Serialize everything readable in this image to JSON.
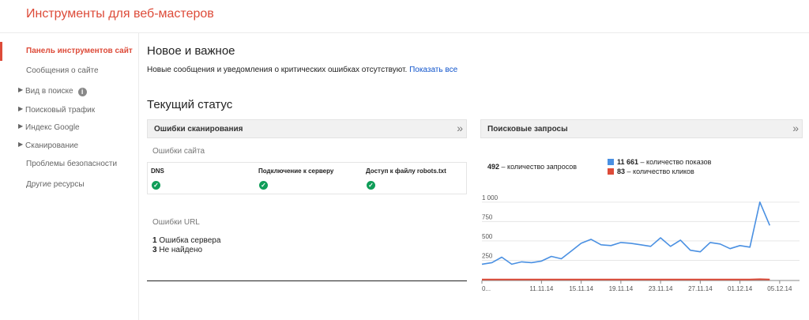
{
  "app": {
    "title": "Инструменты для веб-мастеров"
  },
  "sidebar": {
    "items": [
      {
        "label": "Панель инструментов сайт",
        "active": true,
        "expandable": false
      },
      {
        "label": "Сообщения о сайте",
        "active": false,
        "expandable": false
      },
      {
        "label": "Вид в поиске",
        "active": false,
        "expandable": true,
        "icon": "info-icon"
      },
      {
        "label": "Поисковый трафик",
        "active": false,
        "expandable": true
      },
      {
        "label": "Индекс Google",
        "active": false,
        "expandable": true
      },
      {
        "label": "Сканирование",
        "active": false,
        "expandable": true
      },
      {
        "label": "Проблемы безопасности",
        "active": false,
        "expandable": false
      },
      {
        "label": "Другие ресурсы",
        "active": false,
        "expandable": false
      }
    ]
  },
  "news": {
    "heading": "Новое и важное",
    "text": "Новые сообщения и уведомления о критических ошибках отсутствуют.",
    "link": "Показать все"
  },
  "status": {
    "heading": "Текущий статус"
  },
  "crawl": {
    "title": "Ошибки сканирования",
    "more_glyph": "»",
    "site_errors_label": "Ошибки сайта",
    "columns": [
      {
        "label": "DNS",
        "status": "ok"
      },
      {
        "label": "Подключение к серверу",
        "status": "ok"
      },
      {
        "label": "Доступ к файлу robots.txt",
        "status": "ok"
      }
    ],
    "url_errors_label": "Ошибки URL",
    "url_errors": [
      {
        "count": "1",
        "label": "Ошибка сервера"
      },
      {
        "count": "3",
        "label": "Не найдено"
      }
    ]
  },
  "queries": {
    "title": "Поисковые запросы",
    "more_glyph": "»",
    "count_value": "492",
    "count_label": "– количество запросов",
    "legend": [
      {
        "value": "11 661",
        "label": "– количество показов",
        "color": "#4a90e2"
      },
      {
        "value": "83",
        "label": "– количество кликов",
        "color": "#dd4b39"
      }
    ]
  },
  "chart_data": {
    "type": "line",
    "x": [
      "05.11.14",
      "06.11.14",
      "07.11.14",
      "08.11.14",
      "09.11.14",
      "10.11.14",
      "11.11.14",
      "12.11.14",
      "13.11.14",
      "14.11.14",
      "15.11.14",
      "16.11.14",
      "17.11.14",
      "18.11.14",
      "19.11.14",
      "20.11.14",
      "21.11.14",
      "22.11.14",
      "23.11.14",
      "24.11.14",
      "25.11.14",
      "26.11.14",
      "27.11.14",
      "28.11.14",
      "29.11.14",
      "30.11.14",
      "01.12.14",
      "02.12.14",
      "03.12.14",
      "04.12.14",
      "05.12.14",
      "06.12.14",
      "07.12.14"
    ],
    "tick_labels": [
      "0...",
      "11.11.14",
      "15.11.14",
      "19.11.14",
      "23.11.14",
      "27.11.14",
      "01.12.14",
      "05.12.14"
    ],
    "tick_indices": [
      0,
      6,
      10,
      14,
      18,
      22,
      26,
      30
    ],
    "y_ticks": [
      "1 000",
      "750",
      "500",
      "250"
    ],
    "y_tick_values": [
      1000,
      750,
      500,
      250
    ],
    "ylim": [
      0,
      1100
    ],
    "series": [
      {
        "name": "количество показов",
        "color": "#4a90e2",
        "values": [
          200,
          220,
          290,
          200,
          230,
          220,
          240,
          300,
          270,
          370,
          470,
          520,
          450,
          440,
          480,
          470,
          450,
          430,
          540,
          430,
          510,
          380,
          360,
          480,
          460,
          400,
          440,
          420,
          1000,
          700
        ]
      },
      {
        "name": "количество кликов",
        "color": "#dd4b39",
        "values": [
          2,
          2,
          2,
          2,
          2,
          2,
          2,
          2,
          2,
          2,
          2,
          2,
          2,
          2,
          2,
          2,
          2,
          2,
          2,
          2,
          2,
          2,
          2,
          2,
          2,
          2,
          2,
          2,
          6,
          2
        ]
      }
    ]
  }
}
